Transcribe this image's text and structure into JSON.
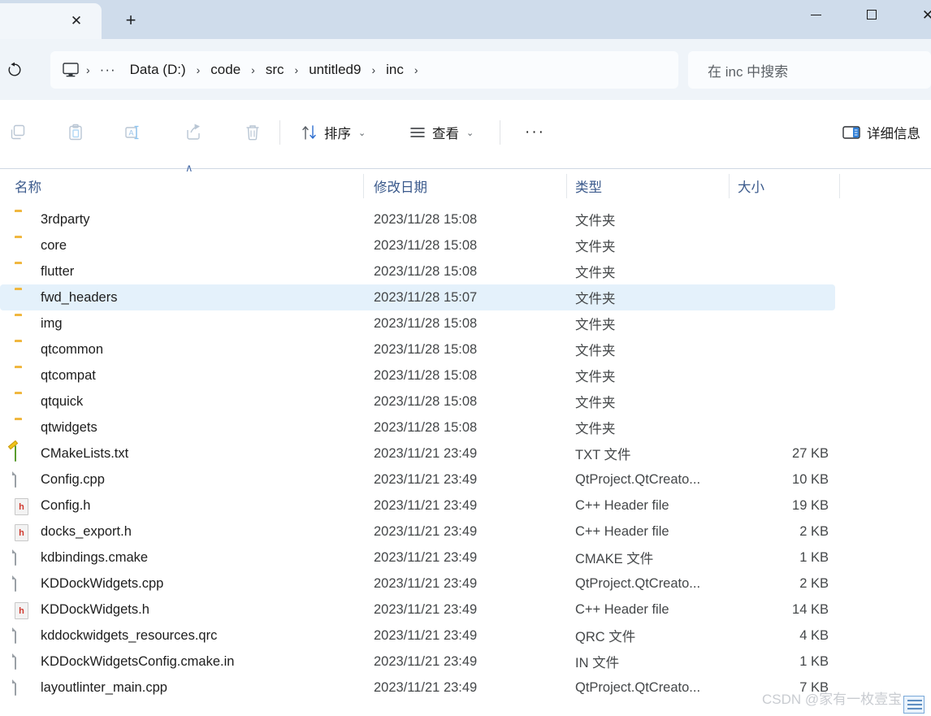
{
  "window": {
    "minimize_label": "—",
    "maximize_label": "",
    "close_label": "✕"
  },
  "tabs": {
    "close_label": "✕",
    "new_tab_label": "+"
  },
  "address": {
    "refresh_icon": "refresh-icon",
    "root_icon": "this-pc-icon",
    "overflow_label": "···",
    "separator": "›",
    "crumbs": [
      "Data (D:)",
      "code",
      "src",
      "untitled9",
      "inc"
    ]
  },
  "search": {
    "placeholder": "在 inc 中搜索"
  },
  "toolbar": {
    "icons": [
      {
        "name": "copy-icon"
      },
      {
        "name": "paste-icon"
      },
      {
        "name": "rename-icon"
      },
      {
        "name": "share-icon"
      },
      {
        "name": "delete-icon"
      }
    ],
    "sort_label": "排序",
    "view_label": "查看",
    "more_label": "···",
    "details_label": "详细信息",
    "chevron": "⌄"
  },
  "columns": {
    "name": "名称",
    "date_modified": "修改日期",
    "type": "类型",
    "size": "大小",
    "sort_indicator": "∧"
  },
  "colors": {
    "titlebar": "#cfdceb",
    "navbar": "#eff4f9",
    "selection": "#e4f1fb",
    "header_text": "#3b5a8c",
    "accent_blue": "#2f6fd0",
    "folder_yellow": "#f6c34b"
  },
  "files": [
    {
      "name": "3rdparty",
      "date": "2023/11/28 15:08",
      "type": "文件夹",
      "size": "",
      "icon": "folder-icon",
      "selected": false
    },
    {
      "name": "core",
      "date": "2023/11/28 15:08",
      "type": "文件夹",
      "size": "",
      "icon": "folder-icon",
      "selected": false
    },
    {
      "name": "flutter",
      "date": "2023/11/28 15:08",
      "type": "文件夹",
      "size": "",
      "icon": "folder-icon",
      "selected": false
    },
    {
      "name": "fwd_headers",
      "date": "2023/11/28 15:07",
      "type": "文件夹",
      "size": "",
      "icon": "folder-icon",
      "selected": true
    },
    {
      "name": "img",
      "date": "2023/11/28 15:08",
      "type": "文件夹",
      "size": "",
      "icon": "folder-icon",
      "selected": false
    },
    {
      "name": "qtcommon",
      "date": "2023/11/28 15:08",
      "type": "文件夹",
      "size": "",
      "icon": "folder-icon",
      "selected": false
    },
    {
      "name": "qtcompat",
      "date": "2023/11/28 15:08",
      "type": "文件夹",
      "size": "",
      "icon": "folder-icon",
      "selected": false
    },
    {
      "name": "qtquick",
      "date": "2023/11/28 15:08",
      "type": "文件夹",
      "size": "",
      "icon": "folder-icon",
      "selected": false
    },
    {
      "name": "qtwidgets",
      "date": "2023/11/28 15:08",
      "type": "文件夹",
      "size": "",
      "icon": "folder-icon",
      "selected": false
    },
    {
      "name": "CMakeLists.txt",
      "date": "2023/11/21 23:49",
      "type": "TXT 文件",
      "size": "27 KB",
      "icon": "txt-file-icon",
      "selected": false
    },
    {
      "name": "Config.cpp",
      "date": "2023/11/21 23:49",
      "type": "QtProject.QtCreato...",
      "size": "10 KB",
      "icon": "generic-file-icon",
      "selected": false
    },
    {
      "name": "Config.h",
      "date": "2023/11/21 23:49",
      "type": "C++ Header file",
      "size": "19 KB",
      "icon": "header-file-icon",
      "selected": false
    },
    {
      "name": "docks_export.h",
      "date": "2023/11/21 23:49",
      "type": "C++ Header file",
      "size": "2 KB",
      "icon": "header-file-icon",
      "selected": false
    },
    {
      "name": "kdbindings.cmake",
      "date": "2023/11/21 23:49",
      "type": "CMAKE 文件",
      "size": "1 KB",
      "icon": "generic-file-icon",
      "selected": false
    },
    {
      "name": "KDDockWidgets.cpp",
      "date": "2023/11/21 23:49",
      "type": "QtProject.QtCreato...",
      "size": "2 KB",
      "icon": "generic-file-icon",
      "selected": false
    },
    {
      "name": "KDDockWidgets.h",
      "date": "2023/11/21 23:49",
      "type": "C++ Header file",
      "size": "14 KB",
      "icon": "header-file-icon",
      "selected": false
    },
    {
      "name": "kddockwidgets_resources.qrc",
      "date": "2023/11/21 23:49",
      "type": "QRC 文件",
      "size": "4 KB",
      "icon": "generic-file-icon",
      "selected": false
    },
    {
      "name": "KDDockWidgetsConfig.cmake.in",
      "date": "2023/11/21 23:49",
      "type": "IN 文件",
      "size": "1 KB",
      "icon": "generic-file-icon",
      "selected": false
    },
    {
      "name": "layoutlinter_main.cpp",
      "date": "2023/11/21 23:49",
      "type": "QtProject.QtCreato...",
      "size": "7 KB",
      "icon": "generic-file-icon",
      "selected": false
    }
  ],
  "watermark": {
    "text": "CSDN @家有一枚壹宝"
  }
}
